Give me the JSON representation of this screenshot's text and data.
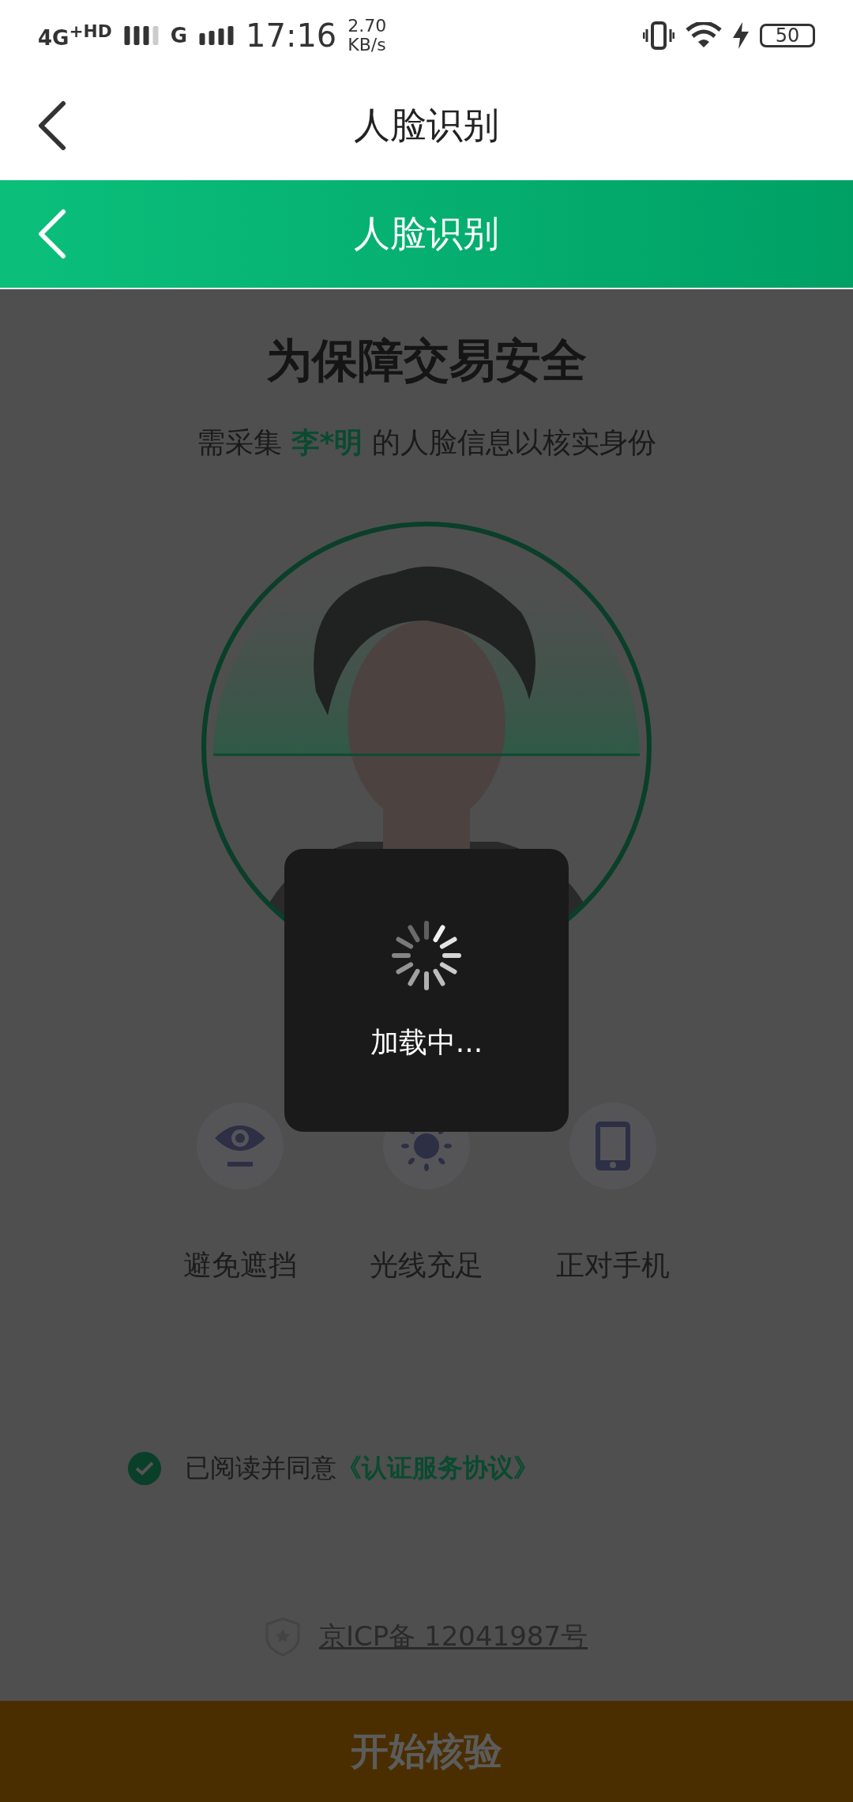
{
  "status_bar": {
    "network": "4G$^{+HD}$",
    "network_2": "G",
    "time": "17:16",
    "speed": "2.70",
    "speed_unit": "KB/s",
    "battery": "50"
  },
  "app_header": {
    "title": "人脸识别"
  },
  "web_header": {
    "title": "人脸识别"
  },
  "heading": "为保障交易安全",
  "subtitle": "需采集 **李*明** 的人脸信息以核实身份",
  "tips": [
    {
      "kind": "eye",
      "label": "避免遮挡"
    },
    {
      "kind": "sun",
      "label": "光线充足"
    },
    {
      "kind": "phone",
      "label": "正对手机"
    }
  ],
  "agreement": {
    "checked": true,
    "text": "已阅读并同意",
    "link": "《认证服务协议》"
  },
  "icp": "京ICP备 12041987号",
  "start_button": "开始核验",
  "toast": "加载中..."
}
